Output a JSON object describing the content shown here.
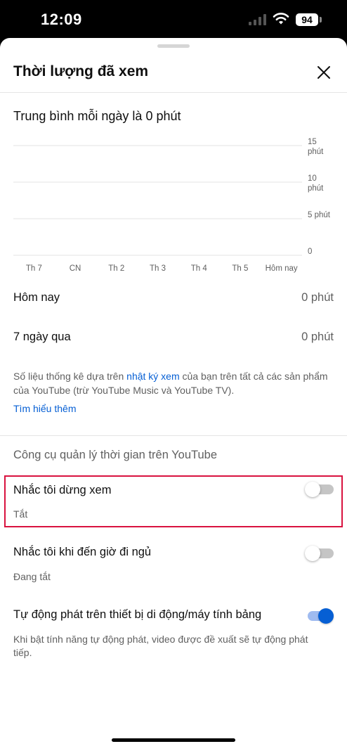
{
  "status_bar": {
    "time": "12:09",
    "battery": "94",
    "icons": [
      "signal-icon",
      "wifi-icon",
      "battery-icon"
    ]
  },
  "sheet": {
    "title": "Thời lượng đã xem",
    "close_icon": "close-icon"
  },
  "summary": {
    "daily_average": "Trung bình mỗi ngày là 0 phút"
  },
  "chart_data": {
    "type": "bar",
    "categories": [
      "Th 7",
      "CN",
      "Th 2",
      "Th 3",
      "Th 4",
      "Th 5",
      "Hôm nay"
    ],
    "values": [
      0,
      0,
      0,
      0,
      0,
      0,
      0
    ],
    "y_ticks": [
      {
        "value": 15,
        "lines": [
          "15",
          "phút"
        ]
      },
      {
        "value": 10,
        "lines": [
          "10",
          "phút"
        ]
      },
      {
        "value": 5,
        "lines": [
          "5 phút"
        ]
      },
      {
        "value": 0,
        "lines": [
          "0"
        ]
      }
    ],
    "ylim": [
      0,
      15
    ],
    "grid": true
  },
  "stats": [
    {
      "label": "Hôm nay",
      "value": "0 phút"
    },
    {
      "label": "7 ngày qua",
      "value": "0 phút"
    }
  ],
  "info": {
    "text_before": "Số liệu thống kê dựa trên ",
    "link": "nhật ký xem",
    "text_after": " của bạn trên tất cả các sản phẩm của YouTube (trừ YouTube Music và YouTube TV).",
    "learn_more": "Tìm hiểu thêm"
  },
  "tools": {
    "section_title": "Công cụ quản lý thời gian trên YouTube",
    "settings": [
      {
        "title": "Nhắc tôi dừng xem",
        "subtitle": "Tắt",
        "enabled": false,
        "highlighted": true
      },
      {
        "title": "Nhắc tôi khi đến giờ đi ngủ",
        "subtitle": "Đang tắt",
        "enabled": false,
        "highlighted": false
      },
      {
        "title": "Tự động phát trên thiết bị di động/máy tính bảng",
        "subtitle": "Khi bật tính năng tự động phát, video được đề xuất sẽ tự động phát tiếp.",
        "enabled": true,
        "highlighted": false
      }
    ]
  },
  "colors": {
    "accent": "#065fd4",
    "highlight_border": "#d9123f",
    "secondary_text": "#606060"
  }
}
